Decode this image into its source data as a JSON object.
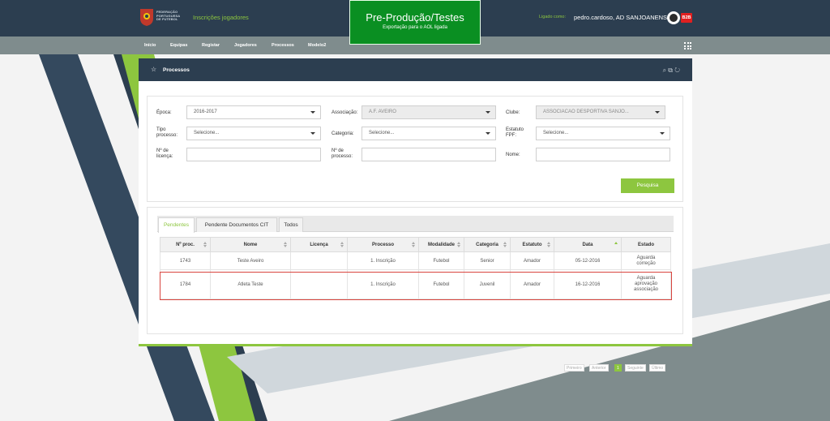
{
  "header": {
    "federation_lines": [
      "FEDERAÇÃO",
      "PORTUGUESA",
      "DE FUTEBOL"
    ],
    "app_title": "Inscrições jogadores",
    "env_title": "Pre-Produção/Testes",
    "env_subtitle": "Exportação para o AOL ligada",
    "login_label": "Ligado como:",
    "login_user": "pedro.cardoso, AD SANJOANENSE",
    "badge": "B2B"
  },
  "nav": {
    "items": [
      "Início",
      "Equipas",
      "Registar",
      "Jogadores",
      "Processos",
      "Modelo2"
    ],
    "apps_icon": "grid-icon"
  },
  "panel": {
    "title": "Processos",
    "star_icon": "star-icon",
    "tools": [
      "search-icon",
      "export-icon",
      "refresh-icon"
    ]
  },
  "filters": {
    "epoca": {
      "label": "Época:",
      "value": "2016-2017"
    },
    "associacao": {
      "label": "Associação:",
      "value": "A.F. AVEIRO"
    },
    "clube": {
      "label": "Clube:",
      "value": "ASSOCIACAO DESPORTIVA SANJO..."
    },
    "tipo_processo": {
      "label_1": "Tipo",
      "label_2": "processo:",
      "value": "Selecione..."
    },
    "categoria": {
      "label": "Categoria:",
      "value": "Selecione..."
    },
    "estatuto": {
      "label_1": "Estatuto",
      "label_2": "FPF:",
      "value": "Selecione..."
    },
    "licenca": {
      "label_1": "Nº de",
      "label_2": "licença:",
      "value": ""
    },
    "n_processo": {
      "label_1": "Nº de",
      "label_2": "processo:",
      "value": ""
    },
    "nome": {
      "label": "Nome:",
      "value": ""
    },
    "search_button": "Pesquisa"
  },
  "tabs": [
    "Pendentes",
    "Pendente Documentos CIT",
    "Todos"
  ],
  "table": {
    "columns": [
      "Nº proc.",
      "Nome",
      "Licença",
      "Processo",
      "Modalidade",
      "Categoria",
      "Estatuto",
      "Data",
      "Estado"
    ],
    "rows": [
      {
        "proc": "1743",
        "nome": "Teste Aveiro",
        "licenca": "",
        "processo": "1. Inscrição",
        "modalidade": "Futebol",
        "categoria": "Senior",
        "estatuto": "Amador",
        "data": "05-12-2016",
        "estado_1": "Aguarda",
        "estado_2": "correção",
        "estado_3": ""
      },
      {
        "proc": "1784",
        "nome": "Atleta Teste",
        "licenca": "",
        "processo": "1. Inscrição",
        "modalidade": "Futebol",
        "categoria": "Juvenil",
        "estatuto": "Amador",
        "data": "16-12-2016",
        "estado_1": "Aguarda",
        "estado_2": "aprovação",
        "estado_3": "associação"
      }
    ]
  },
  "pager": {
    "first": "Primeiro",
    "prev": "Anterior",
    "current": "1",
    "next": "Seguinte",
    "last": "Último"
  },
  "colors": {
    "brand_dark": "#2c3e50",
    "accent_green": "#8dc63f",
    "env_green": "#0a8f22",
    "highlight_red": "#d9453f"
  }
}
